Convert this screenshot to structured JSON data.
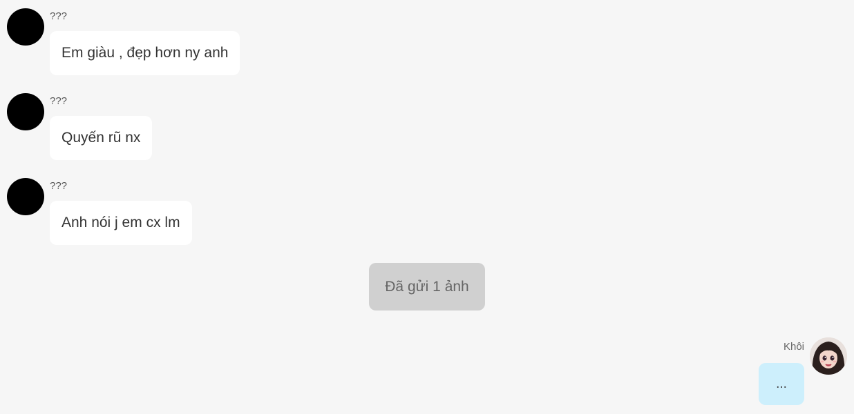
{
  "messages_in": [
    {
      "sender": "???",
      "text": "Em giàu , đẹp hơn ny anh"
    },
    {
      "sender": "???",
      "text": "Quyến rũ nx"
    },
    {
      "sender": "???",
      "text": "Anh nói j em cx lm"
    }
  ],
  "system_note": "Đã gửi 1 ảnh",
  "message_out": {
    "sender": "Khôi",
    "text": "..."
  },
  "colors": {
    "background": "#f6f6f6",
    "incoming_bubble": "#ffffff",
    "outgoing_bubble": "#cdeffc",
    "system_bubble": "#d0d0d0",
    "avatar_placeholder": "#000000"
  },
  "icons": {
    "incoming_avatar": "avatar-placeholder-icon",
    "outgoing_avatar": "anime-girl-avatar"
  }
}
